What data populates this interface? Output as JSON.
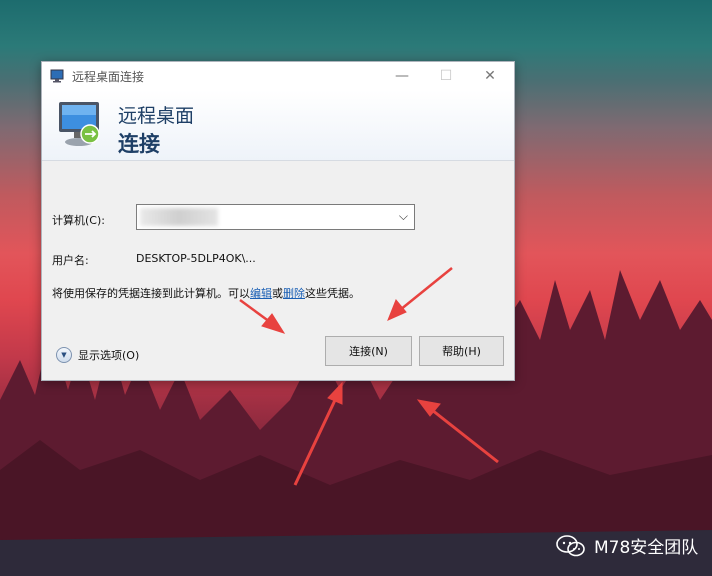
{
  "window": {
    "title": "远程桌面连接",
    "controls": {
      "minimize": "—",
      "maximize": "☐",
      "close": "✕"
    }
  },
  "banner": {
    "line1": "远程桌面",
    "line2": "连接"
  },
  "form": {
    "computer_label": "计算机(C):",
    "computer_value": "",
    "username_label": "用户名:",
    "username_value": "DESKTOP-5DLP4OK\\...",
    "saved_text_prefix": "将使用保存的凭据连接到此计算机。可以",
    "edit_link": "编辑",
    "or_text": "或",
    "delete_link": "删除",
    "saved_text_suffix": "这些凭据。"
  },
  "options_label": "显示选项(O)",
  "buttons": {
    "connect": "连接(N)",
    "help": "帮助(H)"
  },
  "watermark": {
    "text": "M78安全团队"
  },
  "colors": {
    "banner_text": "#1e3f66",
    "link": "#1a5fb4",
    "arrow": "#e8423f"
  }
}
